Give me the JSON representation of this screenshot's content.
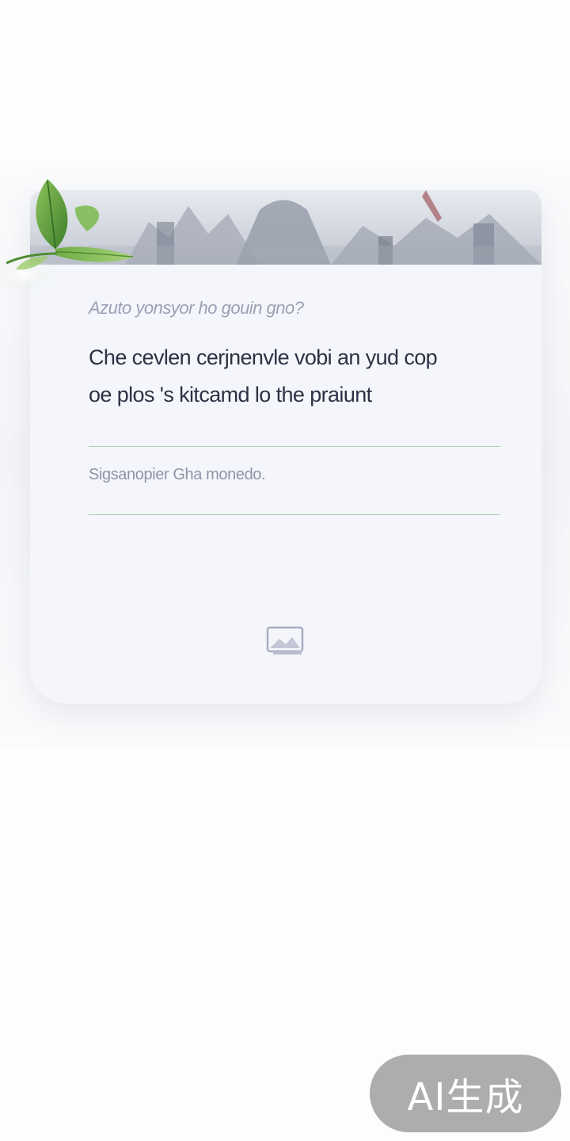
{
  "card": {
    "subtitle": "Azuto yonsyor ho gouin gno?",
    "main_line_1": "Che cevlen cerjnenvle vobi an yud cop",
    "main_line_2": "oe plos 's kitcamd lo the praiunt",
    "note": "Sigsanopier Gha monedo.",
    "banner_icon": "mountain-landscape-image",
    "footer_icon": "image-icon"
  },
  "decoration": {
    "leaf_icon": "green-leaf-icon",
    "accent_color": "#a9d4ad"
  },
  "badge": {
    "label": "AI生成"
  }
}
